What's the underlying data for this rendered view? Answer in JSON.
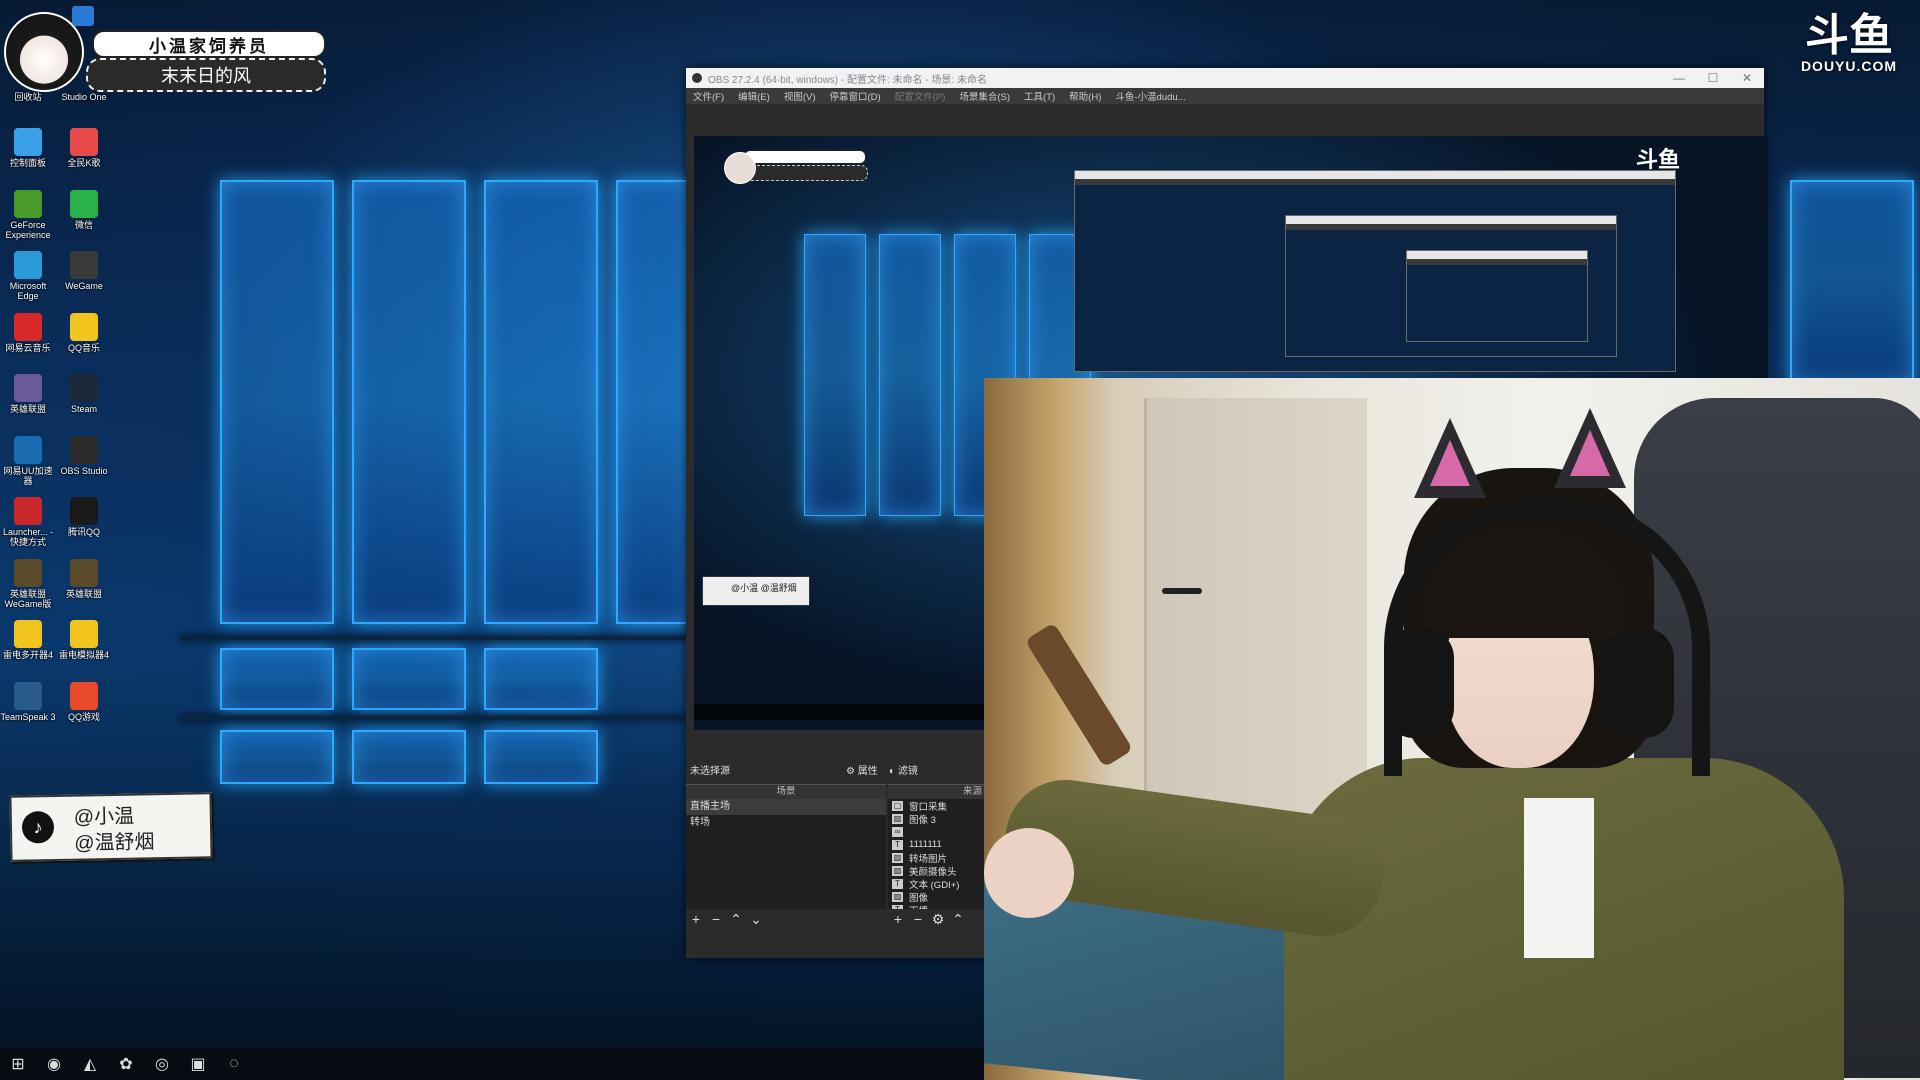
{
  "overlay": {
    "title_line1": "小温家饲养员",
    "title_line2": "末末日的风",
    "tiktok_handle1": "@小温",
    "tiktok_handle2": "@温舒烟",
    "douyu_logo_text": "斗鱼",
    "douyu_url": "DOUYU.COM"
  },
  "desktop": {
    "top_icons": [
      {
        "label": "回收站",
        "icon": "recycle-bin-icon"
      },
      {
        "label": "Studio One",
        "icon": "studio-one-icon"
      }
    ],
    "icons": [
      {
        "label": "控制面板",
        "icon": "control-panel-icon",
        "color": "#3aa0e8"
      },
      {
        "label": "全民K歌",
        "icon": "kge-icon",
        "color": "#e84a4a"
      },
      {
        "label": "GeForce Experience",
        "icon": "geforce-icon",
        "color": "#4a9a2a"
      },
      {
        "label": "微信",
        "icon": "wechat-icon",
        "color": "#2ab24a"
      },
      {
        "label": "Microsoft Edge",
        "icon": "edge-icon",
        "color": "#2a9ad8"
      },
      {
        "label": "WeGame",
        "icon": "wegame-icon",
        "color": "#3a3a3a"
      },
      {
        "label": "网易云音乐",
        "icon": "netease-music-icon",
        "color": "#d8282a"
      },
      {
        "label": "QQ音乐",
        "icon": "qq-music-icon",
        "color": "#f2c41e"
      },
      {
        "label": "英雄联盟",
        "icon": "lol-icon",
        "color": "#6a5a9a"
      },
      {
        "label": "Steam",
        "icon": "steam-icon",
        "color": "#1a2838"
      },
      {
        "label": "网易UU加速器",
        "icon": "uu-icon",
        "color": "#1a6ab0"
      },
      {
        "label": "OBS Studio",
        "icon": "obs-icon",
        "color": "#2a2a2a"
      },
      {
        "label": "Launcher... - 快捷方式",
        "icon": "launcher-icon",
        "color": "#c8282a"
      },
      {
        "label": "腾讯QQ",
        "icon": "qq-icon",
        "color": "#1a1a1a"
      },
      {
        "label": "英雄联盟WeGame版",
        "icon": "lol-wegame-icon",
        "color": "#5a4a2a"
      },
      {
        "label": "英雄联盟",
        "icon": "lol-icon",
        "color": "#5a4a2a"
      },
      {
        "label": "雷电多开器4",
        "icon": "ldmulti-icon",
        "color": "#f2c41e"
      },
      {
        "label": "雷电模拟器4",
        "icon": "ldplayer-icon",
        "color": "#f2c41e"
      },
      {
        "label": "TeamSpeak 3",
        "icon": "teamspeak-icon",
        "color": "#2a5a8a"
      },
      {
        "label": "QQ游戏",
        "icon": "qq-game-icon",
        "color": "#e84a2a"
      }
    ]
  },
  "taskbar": {
    "items": [
      {
        "name": "start-icon",
        "glyph": "⊞"
      },
      {
        "name": "obs-taskbar-icon",
        "glyph": "◉"
      },
      {
        "name": "teamspeak-taskbar-icon",
        "glyph": "◭"
      },
      {
        "name": "kge-taskbar-icon",
        "glyph": "✿"
      },
      {
        "name": "netease-taskbar-icon",
        "glyph": "◎"
      },
      {
        "name": "ldplayer-taskbar-icon",
        "glyph": "▣"
      },
      {
        "name": "music-taskbar-icon",
        "glyph": "◌"
      }
    ]
  },
  "obs": {
    "title": "OBS 27.2.4 (64-bit, windows) - 配置文件: 未命名 - 场景: 未命名",
    "menu": [
      {
        "label": "文件(F)",
        "dim": false
      },
      {
        "label": "编辑(E)",
        "dim": false
      },
      {
        "label": "视图(V)",
        "dim": false
      },
      {
        "label": "停靠窗口(D)",
        "dim": false
      },
      {
        "label": "配置文件(P)",
        "dim": true
      },
      {
        "label": "场景集合(S)",
        "dim": false
      },
      {
        "label": "工具(T)",
        "dim": false
      },
      {
        "label": "帮助(H)",
        "dim": false
      },
      {
        "label": "斗鱼-小温dudu...",
        "dim": false
      }
    ],
    "no_source_selected": "未选择源",
    "properties_button": "属性",
    "filters_button": "滤镜",
    "scenes_header": "场景",
    "sources_header": "来源",
    "scenes": [
      {
        "label": "直播主场",
        "active": true
      },
      {
        "label": "转场",
        "active": false
      }
    ],
    "sources": [
      {
        "label": "窗口采集",
        "icon": "window-icon"
      },
      {
        "label": "图像 3",
        "icon": "image-icon"
      },
      {
        "label": "",
        "icon": "link-icon"
      },
      {
        "label": "1111111",
        "icon": "text-icon"
      },
      {
        "label": "转场图片",
        "icon": "image-icon"
      },
      {
        "label": "美颜摄像头",
        "icon": "image-icon"
      },
      {
        "label": "文本 (GDI+)",
        "icon": "text-icon"
      },
      {
        "label": "图像",
        "icon": "image-icon"
      },
      {
        "label": "下播",
        "icon": "text-icon"
      }
    ],
    "nested_tiktok": "@小温 @温舒烟"
  }
}
